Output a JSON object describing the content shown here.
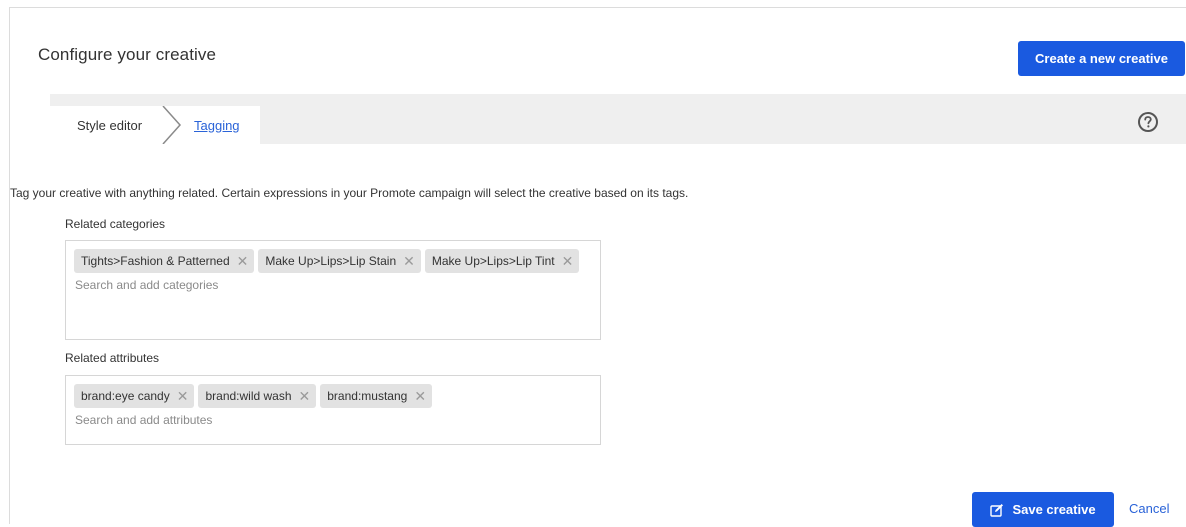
{
  "header": {
    "title": "Configure your creative",
    "create_button": "Create a new creative"
  },
  "tabs": [
    {
      "label": "Style editor",
      "active": false
    },
    {
      "label": "Tagging",
      "active": true
    }
  ],
  "description": "Tag your creative with anything related. Certain expressions in your Promote campaign will select the creative based on its tags.",
  "categories": {
    "label": "Related categories",
    "tags": [
      "Tights>Fashion & Patterned",
      "Make Up>Lips>Lip Stain",
      "Make Up>Lips>Lip Tint"
    ],
    "placeholder": "Search and add categories"
  },
  "attributes": {
    "label": "Related attributes",
    "tags": [
      "brand:eye candy",
      "brand:wild wash",
      "brand:mustang"
    ],
    "placeholder": "Search and add attributes"
  },
  "footer": {
    "save_label": "Save creative",
    "cancel_label": "Cancel"
  },
  "icons": {
    "chip_remove": "close-icon",
    "help": "help-circle-icon",
    "save": "edit-icon"
  },
  "colors": {
    "primary": "#1a5ae0",
    "link": "#2a63d8",
    "chip": "#e2e2e2",
    "tabbar": "#efefef"
  }
}
